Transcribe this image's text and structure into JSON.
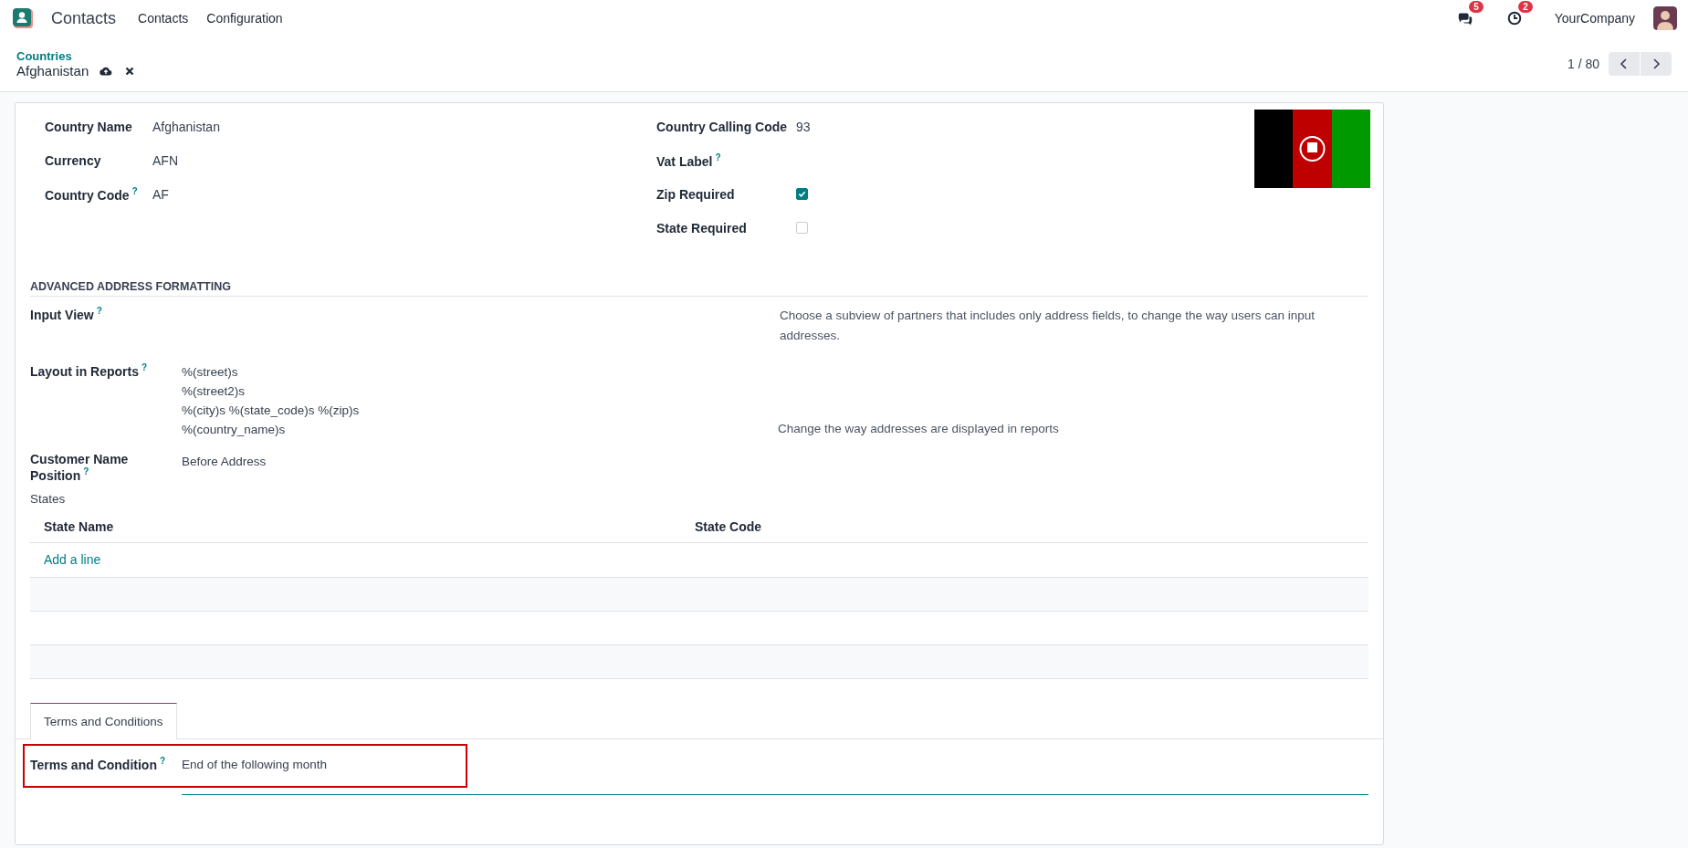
{
  "navbar": {
    "app_name": "Contacts",
    "menus": [
      "Contacts",
      "Configuration"
    ],
    "messages_count": "5",
    "activities_count": "2",
    "company": "YourCompany"
  },
  "breadcrumb": {
    "parent": "Countries",
    "current": "Afghanistan"
  },
  "pager": {
    "text": "1 / 80"
  },
  "left_fields": [
    {
      "label": "Country Name",
      "value": "Afghanistan"
    },
    {
      "label": "Currency",
      "value": "AFN"
    },
    {
      "label": "Country Code",
      "help": "?",
      "value": "AF"
    }
  ],
  "right_fields": [
    {
      "kind": "text",
      "label": "Country Calling Code",
      "value": "93"
    },
    {
      "kind": "text",
      "label": "Vat Label",
      "help": "?"
    },
    {
      "kind": "checkbox",
      "label": "Zip Required",
      "checked": true
    },
    {
      "kind": "checkbox",
      "label": "State Required",
      "checked": false
    }
  ],
  "section_title": "ADVANCED ADDRESS FORMATTING",
  "input_view": {
    "label": "Input View",
    "help": "?",
    "description": "Choose a subview of partners that includes only address fields, to change the way users can input addresses."
  },
  "layout_in_reports": {
    "label": "Layout in Reports",
    "help": "?",
    "lines": [
      "%(street)s",
      "%(street2)s",
      "%(city)s %(state_code)s %(zip)s",
      "%(country_name)s"
    ],
    "description": "Change the way addresses are displayed in reports"
  },
  "customer_name_position": {
    "label": "Customer Name Position",
    "help": "?",
    "value": "Before Address"
  },
  "states": {
    "label": "States",
    "columns": [
      "State Name",
      "State Code"
    ],
    "add_line": "Add a line"
  },
  "tabs": [
    {
      "label": "Terms and Conditions",
      "selected": true
    }
  ],
  "terms": {
    "label": "Terms and Condition",
    "help": "?",
    "value": "End of the following month",
    "highlighted": true
  }
}
